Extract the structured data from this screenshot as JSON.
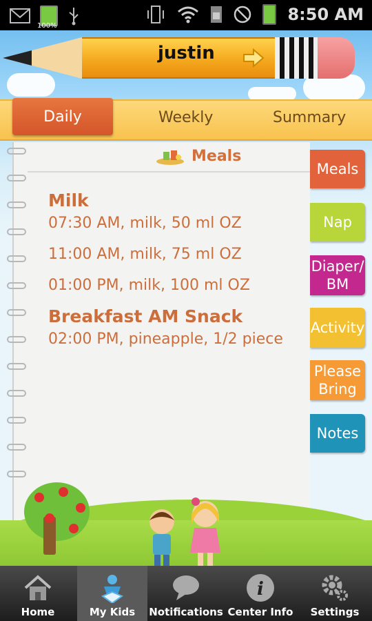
{
  "status_bar": {
    "time": "8:50 AM",
    "battery_label": "100%"
  },
  "header": {
    "child_name": "justin"
  },
  "tabs": [
    {
      "label": "Daily"
    },
    {
      "label": "Weekly"
    },
    {
      "label": "Summary"
    }
  ],
  "notebook": {
    "title": "Meals",
    "sections": [
      {
        "title": "Milk",
        "entries": [
          "07:30 AM, milk, 50 ml OZ",
          "11:00 AM, milk, 75 ml OZ",
          "01:00 PM, milk, 100 ml OZ"
        ]
      },
      {
        "title": "Breakfast AM Snack",
        "entries": [
          "02:00 PM, pineapple, 1/2 piece"
        ]
      }
    ]
  },
  "side_tabs": [
    {
      "label": "Meals",
      "color": "#e2633b"
    },
    {
      "label": "Nap",
      "color": "#b8d63a"
    },
    {
      "label": "Diaper/ BM",
      "color": "#c2288e"
    },
    {
      "label": "Activity",
      "color": "#f2c031"
    },
    {
      "label": "Please Bring",
      "color": "#f59a34"
    },
    {
      "label": "Notes",
      "color": "#1f93b8"
    }
  ],
  "bottom_nav": [
    {
      "label": "Home",
      "icon": "house-icon"
    },
    {
      "label": "My Kids",
      "icon": "kid-icon"
    },
    {
      "label": "Notifications",
      "icon": "speech-bubble-icon"
    },
    {
      "label": "Center Info",
      "icon": "info-icon"
    },
    {
      "label": "Settings",
      "icon": "gear-icon"
    }
  ]
}
